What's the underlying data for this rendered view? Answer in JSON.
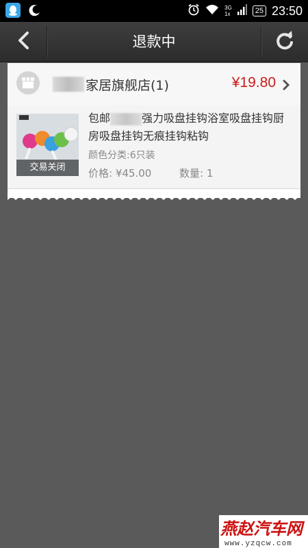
{
  "status_bar": {
    "time": "23:50",
    "battery": "25",
    "network_label": "3G",
    "network_sub": "1x",
    "colors": {
      "app_icon": "#3aa7e8"
    }
  },
  "nav": {
    "title": "退款中",
    "back_icon": "chevron-left-icon",
    "refresh_icon": "refresh-icon"
  },
  "order": {
    "shop_name": "家居旗舰店(1)",
    "total_price": "¥19.80",
    "item": {
      "title_prefix": "包邮",
      "title_rest": "强力吸盘挂钩浴室吸盘挂钩厨房吸盘挂钩无痕挂钩粘钩",
      "spec": "颜色分类:6只装",
      "price": "价格: ¥45.00",
      "quantity": "数量: 1",
      "thumb_status": "交易关闭"
    }
  },
  "watermark": {
    "logo": "燕赵汽车网",
    "url": "www.yzqcw.com"
  },
  "colors": {
    "price_red": "#cc1a1a",
    "background": "#5a5a5a"
  }
}
